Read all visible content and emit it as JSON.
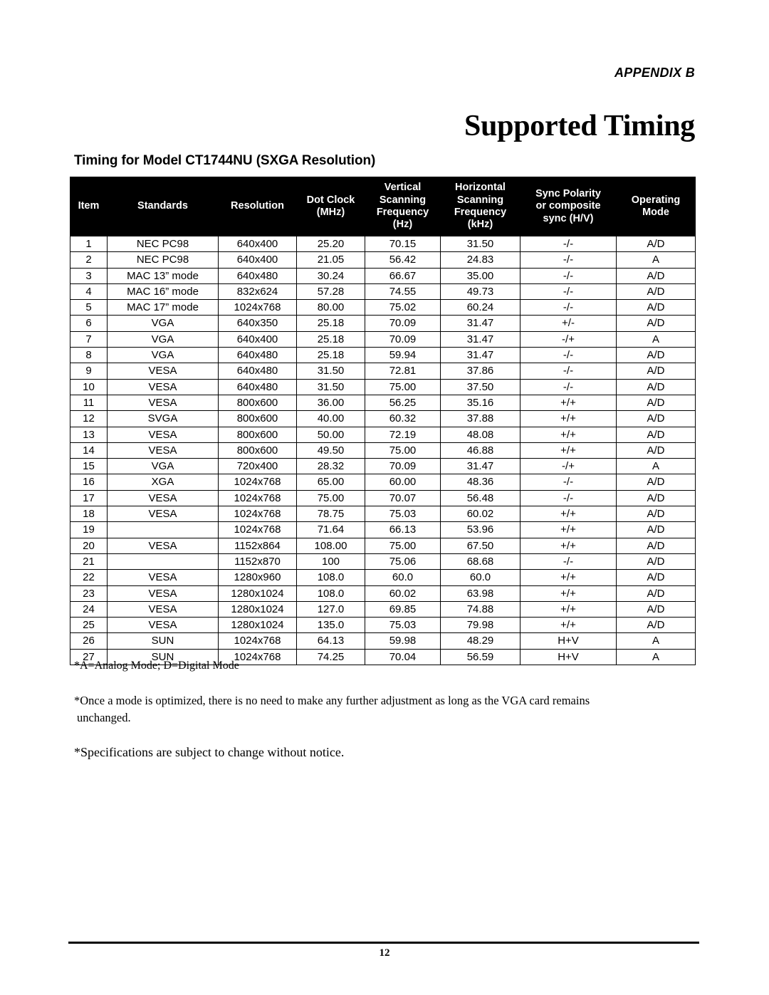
{
  "header": {
    "appendix_label_prefix": "A",
    "appendix_label_rest": "PPENDIX",
    "appendix_label_letter": "B",
    "appendix_label_full": "APPENDIX B",
    "title": "Supported Timing"
  },
  "section": {
    "title": "Timing for Model CT1744NU (SXGA Resolution)"
  },
  "table": {
    "columns": [
      {
        "key": "item",
        "header_lines": [
          "",
          "Item",
          "",
          ""
        ]
      },
      {
        "key": "standards",
        "header_lines": [
          "",
          "Standards",
          "",
          ""
        ]
      },
      {
        "key": "resolution",
        "header_lines": [
          "",
          "Resolution",
          "",
          ""
        ]
      },
      {
        "key": "dot_clock",
        "header_lines": [
          "Dot Clock",
          "(MHz)",
          "",
          ""
        ]
      },
      {
        "key": "vertical",
        "header_lines": [
          "Vertical",
          "Scanning",
          "Frequency",
          "(Hz)"
        ]
      },
      {
        "key": "horizontal",
        "header_lines": [
          "Horizontal",
          "Scanning",
          "Frequency",
          "(kHz)"
        ]
      },
      {
        "key": "sync",
        "header_lines": [
          "Sync Polarity",
          "or composite",
          "sync (H/V)",
          ""
        ]
      },
      {
        "key": "mode",
        "header_lines": [
          "Operating",
          "Mode",
          "",
          ""
        ]
      }
    ],
    "headers": {
      "item": "Item",
      "standards": "Standards",
      "resolution": "Resolution",
      "dot_clock_l1": "Dot Clock",
      "dot_clock_l2": "(MHz)",
      "vertical_l1": "Vertical",
      "vertical_l2": "Scanning",
      "vertical_l3": "Frequency",
      "vertical_l4": "(Hz)",
      "horizontal_l1": "Horizontal",
      "horizontal_l2": "Scanning",
      "horizontal_l3": "Frequency",
      "horizontal_l4": "(kHz)",
      "sync_l1": "Sync Polarity",
      "sync_l2": "or composite",
      "sync_l3": "sync (H/V)",
      "mode_l1": "Operating",
      "mode_l2": "Mode"
    },
    "rows": [
      {
        "item": "1",
        "standards": "NEC PC98",
        "resolution": "640x400",
        "dot_clock": "25.20",
        "vertical": "70.15",
        "horizontal": "31.50",
        "sync": "-/-",
        "mode": "A/D"
      },
      {
        "item": "2",
        "standards": "NEC PC98",
        "resolution": "640x400",
        "dot_clock": "21.05",
        "vertical": "56.42",
        "horizontal": "24.83",
        "sync": "-/-",
        "mode": "A"
      },
      {
        "item": "3",
        "standards": "MAC 13” mode",
        "resolution": "640x480",
        "dot_clock": "30.24",
        "vertical": "66.67",
        "horizontal": "35.00",
        "sync": "-/-",
        "mode": "A/D"
      },
      {
        "item": "4",
        "standards": "MAC 16” mode",
        "resolution": "832x624",
        "dot_clock": "57.28",
        "vertical": "74.55",
        "horizontal": "49.73",
        "sync": "-/-",
        "mode": "A/D"
      },
      {
        "item": "5",
        "standards": "MAC 17” mode",
        "resolution": "1024x768",
        "dot_clock": "80.00",
        "vertical": "75.02",
        "horizontal": "60.24",
        "sync": "-/-",
        "mode": "A/D"
      },
      {
        "item": "6",
        "standards": "VGA",
        "resolution": "640x350",
        "dot_clock": "25.18",
        "vertical": "70.09",
        "horizontal": "31.47",
        "sync": "+/-",
        "mode": "A/D"
      },
      {
        "item": "7",
        "standards": "VGA",
        "resolution": "640x400",
        "dot_clock": "25.18",
        "vertical": "70.09",
        "horizontal": "31.47",
        "sync": "-/+",
        "mode": "A"
      },
      {
        "item": "8",
        "standards": "VGA",
        "resolution": "640x480",
        "dot_clock": "25.18",
        "vertical": "59.94",
        "horizontal": "31.47",
        "sync": "-/-",
        "mode": "A/D"
      },
      {
        "item": "9",
        "standards": "VESA",
        "resolution": "640x480",
        "dot_clock": "31.50",
        "vertical": "72.81",
        "horizontal": "37.86",
        "sync": "-/-",
        "mode": "A/D"
      },
      {
        "item": "10",
        "standards": "VESA",
        "resolution": "640x480",
        "dot_clock": "31.50",
        "vertical": "75.00",
        "horizontal": "37.50",
        "sync": "-/-",
        "mode": "A/D"
      },
      {
        "item": "11",
        "standards": "VESA",
        "resolution": "800x600",
        "dot_clock": "36.00",
        "vertical": "56.25",
        "horizontal": "35.16",
        "sync": "+/+",
        "mode": "A/D"
      },
      {
        "item": "12",
        "standards": "SVGA",
        "resolution": "800x600",
        "dot_clock": "40.00",
        "vertical": "60.32",
        "horizontal": "37.88",
        "sync": "+/+",
        "mode": "A/D"
      },
      {
        "item": "13",
        "standards": "VESA",
        "resolution": "800x600",
        "dot_clock": "50.00",
        "vertical": "72.19",
        "horizontal": "48.08",
        "sync": "+/+",
        "mode": "A/D"
      },
      {
        "item": "14",
        "standards": "VESA",
        "resolution": "800x600",
        "dot_clock": "49.50",
        "vertical": "75.00",
        "horizontal": "46.88",
        "sync": "+/+",
        "mode": "A/D"
      },
      {
        "item": "15",
        "standards": "VGA",
        "resolution": "720x400",
        "dot_clock": "28.32",
        "vertical": "70.09",
        "horizontal": "31.47",
        "sync": "-/+",
        "mode": "A"
      },
      {
        "item": "16",
        "standards": "XGA",
        "resolution": "1024x768",
        "dot_clock": "65.00",
        "vertical": "60.00",
        "horizontal": "48.36",
        "sync": "-/-",
        "mode": "A/D"
      },
      {
        "item": "17",
        "standards": "VESA",
        "resolution": "1024x768",
        "dot_clock": "75.00",
        "vertical": "70.07",
        "horizontal": "56.48",
        "sync": "-/-",
        "mode": "A/D"
      },
      {
        "item": "18",
        "standards": "VESA",
        "resolution": "1024x768",
        "dot_clock": "78.75",
        "vertical": "75.03",
        "horizontal": "60.02",
        "sync": "+/+",
        "mode": "A/D"
      },
      {
        "item": "19",
        "standards": "",
        "resolution": "1024x768",
        "dot_clock": "71.64",
        "vertical": "66.13",
        "horizontal": "53.96",
        "sync": "+/+",
        "mode": "A/D"
      },
      {
        "item": "20",
        "standards": "VESA",
        "resolution": "1152x864",
        "dot_clock": "108.00",
        "vertical": "75.00",
        "horizontal": "67.50",
        "sync": "+/+",
        "mode": "A/D"
      },
      {
        "item": "21",
        "standards": "",
        "resolution": "1152x870",
        "dot_clock": "100",
        "vertical": "75.06",
        "horizontal": "68.68",
        "sync": "-/-",
        "mode": "A/D"
      },
      {
        "item": "22",
        "standards": "VESA",
        "resolution": "1280x960",
        "dot_clock": "108.0",
        "vertical": "60.0",
        "horizontal": "60.0",
        "sync": "+/+",
        "mode": "A/D"
      },
      {
        "item": "23",
        "standards": "VESA",
        "resolution": "1280x1024",
        "dot_clock": "108.0",
        "vertical": "60.02",
        "horizontal": "63.98",
        "sync": "+/+",
        "mode": "A/D"
      },
      {
        "item": "24",
        "standards": "VESA",
        "resolution": "1280x1024",
        "dot_clock": "127.0",
        "vertical": "69.85",
        "horizontal": "74.88",
        "sync": "+/+",
        "mode": "A/D"
      },
      {
        "item": "25",
        "standards": "VESA",
        "resolution": "1280x1024",
        "dot_clock": "135.0",
        "vertical": "75.03",
        "horizontal": "79.98",
        "sync": "+/+",
        "mode": "A/D"
      },
      {
        "item": "26",
        "standards": "SUN",
        "resolution": "1024x768",
        "dot_clock": "64.13",
        "vertical": "59.98",
        "horizontal": "48.29",
        "sync": "H+V",
        "mode": "A"
      },
      {
        "item": "27",
        "standards": "SUN",
        "resolution": "1024x768",
        "dot_clock": "74.25",
        "vertical": "70.04",
        "horizontal": "56.59",
        "sync": "H+V",
        "mode": "A"
      }
    ]
  },
  "notes": {
    "analog_digital": "*A=Analog Mode; D=Digital Mode",
    "optimized_line1": "*Once a mode is optimized, there is no need to make any further adjustment as long as the VGA card remains",
    "optimized_line2": "unchanged.",
    "specifications": "*Specifications are subject to change without notice."
  },
  "footer": {
    "page_number": "12"
  }
}
